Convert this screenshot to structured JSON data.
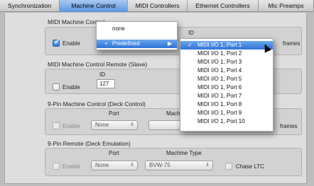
{
  "tabs": [
    {
      "label": "Synchronization"
    },
    {
      "label": "Machine Control"
    },
    {
      "label": "MIDI Controllers"
    },
    {
      "label": "Ethernet Controllers"
    },
    {
      "label": "Mic Preamps"
    }
  ],
  "group1": {
    "title": "MIDI Machine Control",
    "enable_label": "Enable",
    "enable_checked": true,
    "id_header": "ID",
    "frames_label": "frames"
  },
  "group2": {
    "title": "MIDI Machine Control Remote (Slave)",
    "enable_label": "Enable",
    "enable_checked": false,
    "id_header": "ID",
    "id_value": "127"
  },
  "group3": {
    "title": "9-Pin Machine Control (Deck Control)",
    "enable_label": "Enable",
    "port_header": "Port",
    "port_value": "None",
    "machine_header": "Machine Type",
    "frames_label": "frames"
  },
  "group4": {
    "title": "9-Pin Remote (Deck Emulation)",
    "enable_label": "Enable",
    "port_header": "Port",
    "port_value": "None",
    "machine_header": "Machine Type",
    "machine_value": "BVW-75",
    "chase_label": "Chase LTC"
  },
  "menu1": {
    "items": [
      {
        "label": "none"
      },
      {
        "label": "Predefined",
        "highlighted": true,
        "submenu": true
      }
    ],
    "submenu_arrow": "▶"
  },
  "menu2": {
    "check_mark": "✓",
    "items": [
      {
        "label": "MIDI I/O 1, Port 1",
        "selected": true
      },
      {
        "label": "MIDI I/O 1, Port 2"
      },
      {
        "label": "MIDI I/O 1, Port 3"
      },
      {
        "label": "MIDI I/O 1, Port 4"
      },
      {
        "label": "MIDI I/O 1, Port 5"
      },
      {
        "label": "MIDI I/O 1, Port 6"
      },
      {
        "label": "MIDI I/O 1, Port 7"
      },
      {
        "label": "MIDI I/O 1, Port 8"
      },
      {
        "label": "MIDI I/O 1, Port 9"
      },
      {
        "label": "MIDI I/O 1, Port 10"
      }
    ]
  },
  "popup_arrow": "⇕",
  "colors": {
    "accent": "#3478d8",
    "tab_active": "#5a96e0"
  }
}
